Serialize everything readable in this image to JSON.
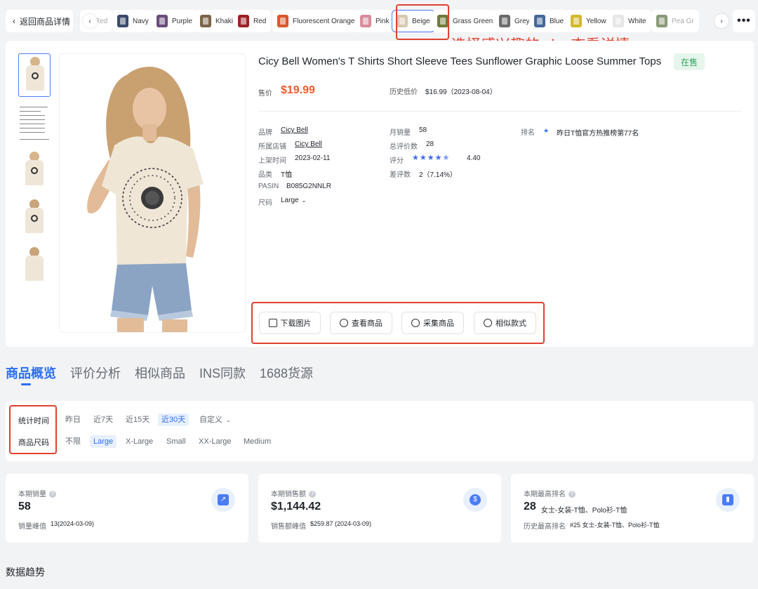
{
  "header": {
    "back_label": "返回商品详情",
    "more_label": "•••"
  },
  "sku_chips": [
    {
      "label": "Red",
      "color": "#c9c9c9",
      "faded": true
    },
    {
      "label": "Navy",
      "color": "#3a4a6b"
    },
    {
      "label": "Purple",
      "color": "#6b4b7c"
    },
    {
      "label": "Khaki",
      "color": "#7b6448"
    },
    {
      "label": "Red",
      "color": "#9e2125"
    },
    {
      "label": "Fluorescent Orange",
      "color": "#d9582c"
    },
    {
      "label": "Pink",
      "color": "#d88d9c"
    },
    {
      "label": "Beige",
      "color": "#d8c9b0",
      "active": true
    },
    {
      "label": "Grass Green",
      "color": "#6f7b3a"
    },
    {
      "label": "Grey",
      "color": "#6c6c6c"
    },
    {
      "label": "Blue",
      "color": "#46689b"
    },
    {
      "label": "Yellow",
      "color": "#d4b92a"
    },
    {
      "label": "White",
      "color": "#e6e6e6"
    },
    {
      "label": "Pea Gr",
      "color": "#8a9a7a",
      "faded": true
    }
  ],
  "annotation": "选择感兴趣的 sku 查看详情",
  "product": {
    "title": "Cicy Bell Women's T Shirts Short Sleeve Tees Sunflower Graphic Loose Summer Tops",
    "status": "在售",
    "price_label": "售价",
    "price": "$19.99",
    "lowest_label": "历史低价",
    "lowest_value": "$16.99（2023-08-04）",
    "attrs": {
      "brand_label": "品牌",
      "brand": "Cicy Bell",
      "store_label": "所属店铺",
      "store": "Cicy Bell",
      "listed_label": "上架时间",
      "listed": "2023-02-11",
      "category_label": "品类",
      "category": "T恤",
      "pasin_label": "PASIN",
      "pasin": "B085G2NNLR",
      "size_label": "尺码",
      "size": "Large",
      "monthly_sales_label": "月销量",
      "monthly_sales": "58",
      "reviews_label": "总评价数",
      "reviews": "28",
      "rating_label": "评分",
      "rating": "4.40",
      "rating_value": 4.4,
      "negative_label": "差评数",
      "negative": "2（7.14%）",
      "rank_label": "排名",
      "rank": "昨日T恤官方热推榜第77名"
    },
    "actions": [
      "下载图片",
      "查看商品",
      "采集商品",
      "相似款式"
    ]
  },
  "tabs": [
    "商品概览",
    "评价分析",
    "相似商品",
    "INS同款",
    "1688货源"
  ],
  "filters": {
    "time_label": "统计时间",
    "time_options": [
      "昨日",
      "近7天",
      "近15天",
      "近30天",
      "自定义"
    ],
    "time_active": "近30天",
    "size_label": "商品尺码",
    "size_options": [
      "不限",
      "Large",
      "X-Large",
      "Small",
      "XX-Large",
      "Medium"
    ],
    "size_active": "Large"
  },
  "stats": {
    "sales": {
      "title": "本期销量",
      "value": "58",
      "sub_label": "销量峰值",
      "sub_value": "13(2024-03-09)"
    },
    "revenue": {
      "title": "本期销售额",
      "value": "$1,144.42",
      "sub_label": "销售额峰值",
      "sub_value": "$259.87 (2024-03-09)"
    },
    "rank": {
      "title": "本期最高排名",
      "value": "28",
      "value_extra": "女士-女装-T恤、Polo衫-T恤",
      "sub_label": "历史最高排名",
      "sub_value": "#25 女士-女装-T恤、Polo衫-T恤"
    }
  },
  "trend_title": "数据趋势",
  "colors": {
    "accent": "#2b6ef2",
    "price": "#f25a2c",
    "annotation": "#e0402f",
    "status_green": "#2ea35b"
  }
}
